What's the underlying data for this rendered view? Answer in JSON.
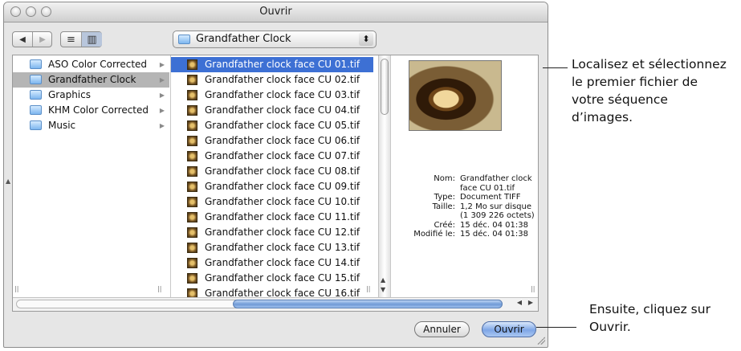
{
  "window": {
    "title": "Ouvrir"
  },
  "toolbar": {
    "back_glyph": "◀",
    "forward_glyph": "▶",
    "list_view_glyph": "≡",
    "column_view_glyph": "▥",
    "path_popup_label": "Grandfather Clock",
    "path_popup_stepper": "⬍"
  },
  "browser": {
    "folders": [
      {
        "label": "ASO Color Corrected",
        "has_children": true
      },
      {
        "label": "Grandfather Clock",
        "has_children": true,
        "selected": true
      },
      {
        "label": "Graphics",
        "has_children": true
      },
      {
        "label": "KHM Color Corrected",
        "has_children": true
      },
      {
        "label": "Music",
        "has_children": true
      }
    ],
    "files": [
      "Grandfather clock face CU 01.tif",
      "Grandfather clock face CU 02.tif",
      "Grandfather clock face CU 03.tif",
      "Grandfather clock face CU 04.tif",
      "Grandfather clock face CU 05.tif",
      "Grandfather clock face CU 06.tif",
      "Grandfather clock face CU 07.tif",
      "Grandfather clock face CU 08.tif",
      "Grandfather clock face CU 09.tif",
      "Grandfather clock face CU 10.tif",
      "Grandfather clock face CU 11.tif",
      "Grandfather clock face CU 12.tif",
      "Grandfather clock face CU 13.tif",
      "Grandfather clock face CU 14.tif",
      "Grandfather clock face CU 15.tif",
      "Grandfather clock face CU 16.tif"
    ],
    "selected_file_index": 0
  },
  "preview": {
    "info": [
      {
        "key": "Nom:",
        "value": "Grandfather clock"
      },
      {
        "key": "",
        "value": "face CU 01.tif"
      },
      {
        "key": "Type:",
        "value": "Document TIFF"
      },
      {
        "key": "Taille:",
        "value": "1,2 Mo sur disque"
      },
      {
        "key": "",
        "value": "(1 309 226 octets)"
      },
      {
        "key": "Créé:",
        "value": "15 déc. 04 01:38"
      },
      {
        "key": "Modifié le:",
        "value": "15 déc. 04 01:38"
      }
    ]
  },
  "buttons": {
    "cancel": "Annuler",
    "open": "Ouvrir"
  },
  "callouts": {
    "top": [
      "Localisez et sélectionnez",
      "le premier fichier de",
      "votre séquence",
      "d’images."
    ],
    "bottom": [
      "Ensuite, cliquez sur",
      "Ouvrir."
    ]
  },
  "colors": {
    "selection": "#3d70d4",
    "accent": "#7ea6e6"
  }
}
